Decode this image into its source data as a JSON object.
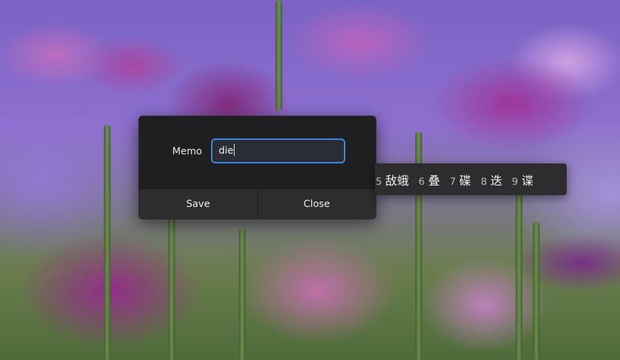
{
  "dialog": {
    "memo_label": "Memo",
    "memo_value": "die",
    "save_label": "Save",
    "close_label": "Close",
    "accent_color": "#3a8ee6"
  },
  "ime": {
    "candidates": [
      {
        "num": "5",
        "text": "敌蛾"
      },
      {
        "num": "6",
        "text": "叠"
      },
      {
        "num": "7",
        "text": "碟"
      },
      {
        "num": "8",
        "text": "迭"
      },
      {
        "num": "9",
        "text": "谍"
      }
    ]
  }
}
